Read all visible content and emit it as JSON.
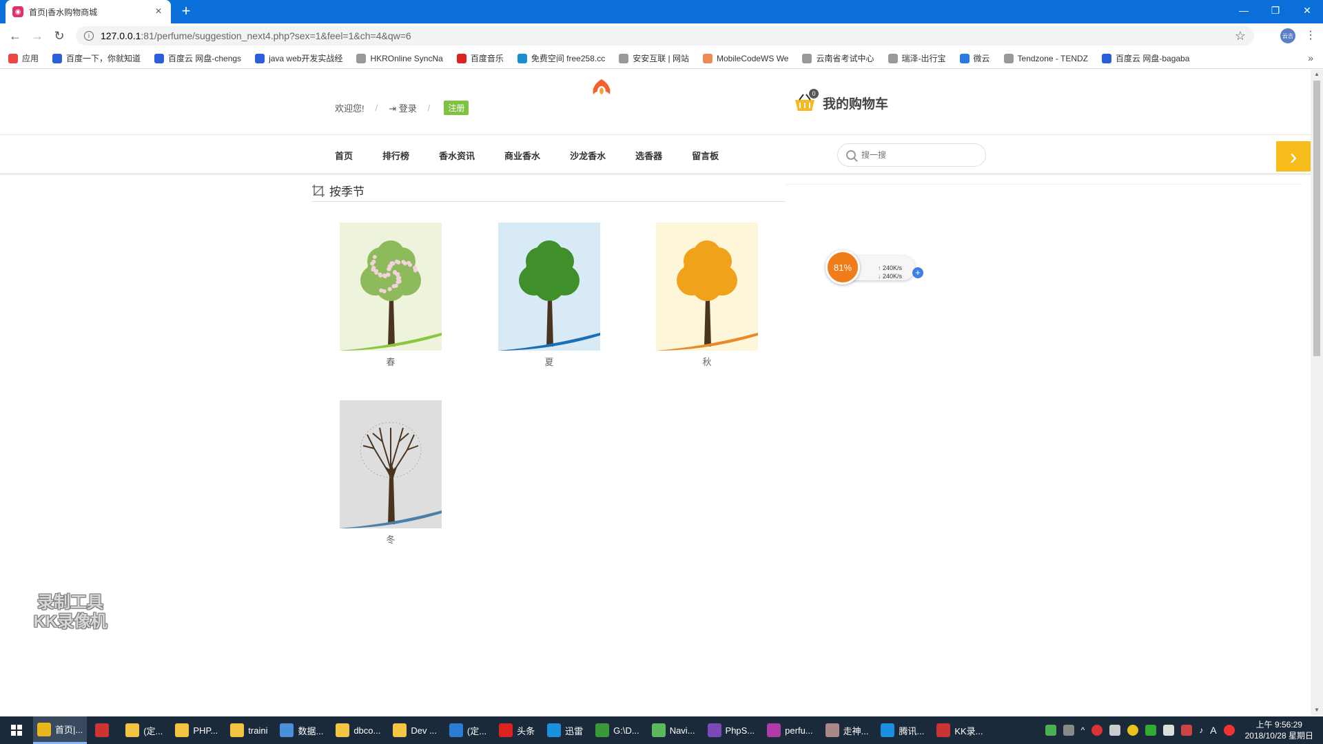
{
  "browser": {
    "tab_title": "首页|香水购物商城",
    "url_host": "127.0.0.1",
    "url_rest": ":81/perfume/suggestion_next4.php?sex=1&feel=1&ch=4&qw=6",
    "profile_label": "云吉"
  },
  "bookmarks": [
    {
      "label": "应用",
      "color": "#e44"
    },
    {
      "label": "百度一下，你就知道",
      "color": "#2b5fd9"
    },
    {
      "label": "百度云 网盘-chengs",
      "color": "#2b5fd9"
    },
    {
      "label": "java web开发实战经",
      "color": "#2b5fd9"
    },
    {
      "label": "HKROnline SyncNa",
      "color": "#999"
    },
    {
      "label": "百度音乐",
      "color": "#d22"
    },
    {
      "label": "免费空间 free258.cc",
      "color": "#1a8fd0"
    },
    {
      "label": "安安互联 | 网站",
      "color": "#999"
    },
    {
      "label": "MobileCodeWS We",
      "color": "#e85"
    },
    {
      "label": "云南省考试中心",
      "color": "#999"
    },
    {
      "label": "瑞泽-出行宝",
      "color": "#999"
    },
    {
      "label": "微云",
      "color": "#2a7ae2"
    },
    {
      "label": "Tendzone - TENDZ",
      "color": "#999"
    },
    {
      "label": "百度云 网盘-bagaba",
      "color": "#2b5fd9"
    }
  ],
  "header": {
    "welcome": "欢迎您!",
    "sep": "/",
    "login": "登录",
    "register": "注册",
    "cart_count": "0",
    "cart_label": "我的购物车"
  },
  "nav": {
    "items": [
      "首页",
      "排行榜",
      "香水资讯",
      "商业香水",
      "沙龙香水",
      "选香器",
      "留言板"
    ],
    "search_placeholder": "搜一搜"
  },
  "section": {
    "title": "按季节"
  },
  "seasons": [
    {
      "label": "春",
      "bg": "#eef3dc",
      "foliage": "#8dbb5c",
      "blossom": "#f2d2dc",
      "swoosh": "#8cc63f"
    },
    {
      "label": "夏",
      "bg": "#d9eaf7",
      "foliage": "#3f8f2a",
      "blossom": "",
      "swoosh": "#1a6fb5"
    },
    {
      "label": "秋",
      "bg": "#fdf6d8",
      "foliage": "#f0a21a",
      "blossom": "",
      "swoosh": "#e88a2a"
    },
    {
      "label": "冬",
      "bg": "#dedede",
      "foliage": "",
      "blossom": "",
      "swoosh": "#4a7fa8"
    }
  ],
  "net_widget": {
    "percent": "81%",
    "up": "240K/s",
    "down": "240K/s"
  },
  "watermark": {
    "line1": "录制工具",
    "line2": "KK录像机"
  },
  "taskbar": {
    "items": [
      {
        "label": "首页|...",
        "color": "#e8b71a",
        "active": true
      },
      {
        "label": "",
        "color": "#c33"
      },
      {
        "label": "(定...",
        "color": "#f4c542"
      },
      {
        "label": "PHP...",
        "color": "#f4c542"
      },
      {
        "label": "traini",
        "color": "#f4c542"
      },
      {
        "label": "数据...",
        "color": "#4a90d9"
      },
      {
        "label": "dbco...",
        "color": "#f4c542"
      },
      {
        "label": "Dev ...",
        "color": "#f4c542"
      },
      {
        "label": "(定...",
        "color": "#2b7cd3"
      },
      {
        "label": "头条",
        "color": "#d22"
      },
      {
        "label": "迅雷",
        "color": "#1a8fe0"
      },
      {
        "label": "G:\\D...",
        "color": "#3a9a3a"
      },
      {
        "label": "Navi...",
        "color": "#5cb85c"
      },
      {
        "label": "PhpS...",
        "color": "#7a4ab8"
      },
      {
        "label": "perfu...",
        "color": "#b03aa8"
      },
      {
        "label": "走神...",
        "color": "#a88"
      },
      {
        "label": "腾讯...",
        "color": "#1a8fe0"
      },
      {
        "label": "KK录...",
        "color": "#c33"
      }
    ],
    "time": "上午 9:56:29",
    "date": "2018/10/28 星期日",
    "ime": "A"
  }
}
